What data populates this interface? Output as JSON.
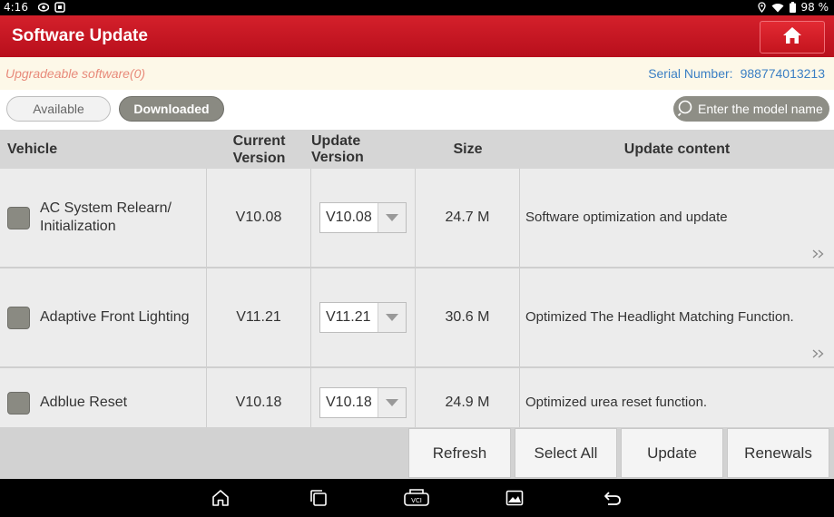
{
  "status_bar": {
    "time": "4:16",
    "battery": "98 %"
  },
  "header": {
    "title": "Software Update"
  },
  "info": {
    "upgradeable": "Upgradeable software(0)",
    "serial_label": "Serial Number:",
    "serial_value": "988774013213"
  },
  "filters": {
    "available": "Available",
    "downloaded": "Downloaded",
    "search_placeholder": "Enter the model name"
  },
  "table": {
    "headers": {
      "vehicle": "Vehicle",
      "current_version": "Current Version",
      "update_version": "Update Version",
      "size": "Size",
      "update_content": "Update content"
    },
    "rows": [
      {
        "vehicle": "AC System Relearn/ Initialization",
        "current_version": "V10.08",
        "update_version": "V10.08",
        "size": "24.7 M",
        "content": "Software optimization and update"
      },
      {
        "vehicle": "Adaptive Front Lighting",
        "current_version": "V11.21",
        "update_version": "V11.21",
        "size": "30.6 M",
        "content": "Optimized The Headlight Matching Function."
      },
      {
        "vehicle": "Adblue Reset",
        "current_version": "V10.18",
        "update_version": "V10.18",
        "size": "24.9 M",
        "content": "Optimized urea reset function."
      }
    ]
  },
  "actions": {
    "refresh": "Refresh",
    "select_all": "Select All",
    "update": "Update",
    "renewals": "Renewals"
  },
  "icons": {
    "home": "home-icon",
    "search": "search-icon",
    "more": "double-chevron-right-icon",
    "nav": [
      "home-icon",
      "recent-apps-icon",
      "vci-icon",
      "gallery-icon",
      "back-icon"
    ]
  },
  "colors": {
    "header_red": "#c8161f",
    "serial_blue": "#3b7fc4",
    "upgradeable_text": "#e88a7a",
    "checkbox_gray": "#8a8a82"
  }
}
